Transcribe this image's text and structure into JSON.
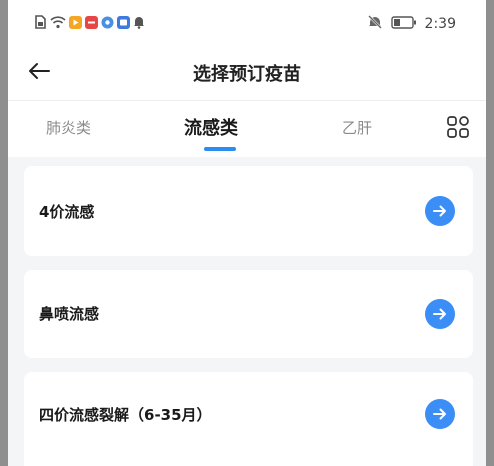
{
  "status_bar": {
    "time": "2:39",
    "left_icons": [
      "sim-icon",
      "wifi-icon",
      "app-icon-orange",
      "app-icon-red",
      "app-icon-blue",
      "app-icon-blue2",
      "notification-bell-icon"
    ],
    "right_icons": [
      "mute-icon",
      "battery-icon"
    ]
  },
  "header": {
    "back_icon": "arrow-left-icon",
    "title": "选择预订疫苗"
  },
  "tabs": [
    {
      "label": "肺炎类",
      "active": false
    },
    {
      "label": "流感类",
      "active": true
    },
    {
      "label": "乙肝",
      "active": false
    }
  ],
  "tab_menu_icon": "grid-icon",
  "vaccines": [
    {
      "name": "4价流感"
    },
    {
      "name": "鼻喷流感"
    },
    {
      "name": "四价流感裂解（6-35月）"
    }
  ],
  "colors": {
    "accent": "#2d8cf0",
    "arrow_button": "#3a8ef6",
    "page_background": "#f4f5f7",
    "card_background": "#ffffff"
  }
}
